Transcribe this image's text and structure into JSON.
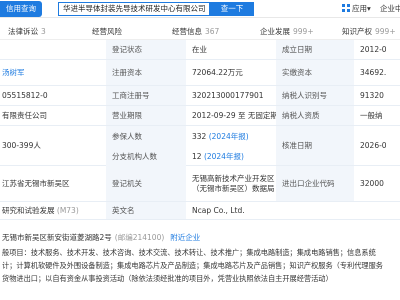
{
  "topbar": {
    "brand": "信用查询",
    "search_value": "华进半导体封装先导技术研发中心有限公司",
    "search_button": "查一下",
    "app_label": "应用",
    "enterprise_label": "企业中心"
  },
  "tabs": [
    {
      "label": "法律诉讼",
      "count": "3"
    },
    {
      "label": "经营风险",
      "count": ""
    },
    {
      "label": "经营信息",
      "count": "367"
    },
    {
      "label": "企业发展",
      "count": "999+"
    },
    {
      "label": "知识产权",
      "count": "999+"
    }
  ],
  "rows": {
    "r1": {
      "c0": "",
      "c1": "登记状态",
      "c2": "在业",
      "c3": "成立日期",
      "c4": "2012-0"
    },
    "r2": {
      "c0": "汤树军",
      "c1": "注册资本",
      "c2": "72064.22万元",
      "c3": "实缴资本",
      "c4": "34692."
    },
    "r3": {
      "c0": "05515812-0",
      "c1": "工商注册号",
      "c2": "320213000177901",
      "c3": "纳税人识别号",
      "c4": "91320"
    },
    "r4": {
      "c0": "有限责任公司",
      "c1": "营业期限",
      "c2": "2012-09-29 至 无固定期限",
      "c3": "纳税人资质",
      "c4": "一般纳"
    },
    "r5": {
      "c0": "300-399人",
      "c1": "参保人数",
      "c2": "332",
      "c2_note": "(2024年报)",
      "c3": "核准日期",
      "c4": "2026-0"
    },
    "r6": {
      "c0": "",
      "c1": "分支机构人数",
      "c2": "12",
      "c2_note": "(2024年报)",
      "c3": "",
      "c4": ""
    },
    "r7": {
      "c0": "江苏省无锡市新吴区",
      "c1": "登记机关",
      "c2": "无锡高新技术产业开发区（无锡市新吴区）数据局",
      "c3": "进出口企业代码",
      "c4": "32000"
    },
    "r8": {
      "c0": "研究和试验发展",
      "c0_note": "(M73)",
      "c1": "英文名",
      "c2": "Ncap Co., Ltd."
    }
  },
  "address": {
    "text": "无锡市新吴区新安街道菱湖路2号",
    "postcode": "(邮编214100)",
    "nearby": "附近企业"
  },
  "scope_lines": [
    "般项目：技术服务、技术开发、技术咨询、技术交流、技术转让、技术推广；集成电路制造；集成电路销售；信息系统",
    "计；计算机软硬件及外围设备制造；集成电路芯片及产品制造；集成电路芯片及产品销售；知识产权服务（专利代理服务",
    "货物进出口；以自有资金从事投资活动（除依法须经批准的项目外，凭营业执照依法自主开展经营活动）"
  ],
  "colors": {
    "accent": "#1e7be0",
    "label_bg": "#f2f6fb"
  }
}
